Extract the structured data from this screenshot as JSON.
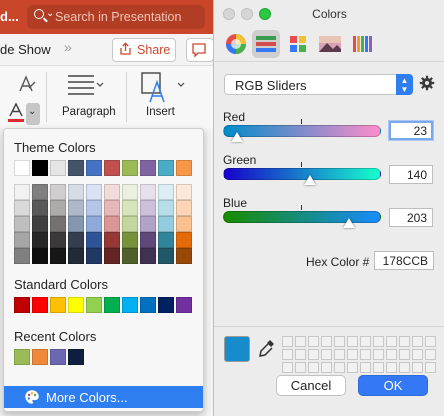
{
  "ppt": {
    "title_fragment": "d...",
    "search_placeholder": "Search in Presentation",
    "tab_fragment": "de Show",
    "tabs_more": "»",
    "share_label": "Share",
    "paragraph_label": "Paragraph",
    "insert_label": "Insert"
  },
  "dropdown": {
    "theme_label": "Theme Colors",
    "standard_label": "Standard Colors",
    "recent_label": "Recent Colors",
    "more_label": "More Colors...",
    "theme_top": [
      "#ffffff",
      "#000000",
      "#e7e6e6",
      "#44546a",
      "#4472c4",
      "#c0504d",
      "#9bbb59",
      "#8064a2",
      "#4bacc6",
      "#f79646"
    ],
    "theme_shades": [
      [
        "#f2f2f2",
        "#d9d9d9",
        "#bfbfbf",
        "#a6a6a6",
        "#808080"
      ],
      [
        "#7f7f7f",
        "#595959",
        "#404040",
        "#262626",
        "#0d0d0d"
      ],
      [
        "#d0cece",
        "#aeabab",
        "#757171",
        "#3a3838",
        "#171616"
      ],
      [
        "#d6dce5",
        "#adb9ca",
        "#8497b0",
        "#333f50",
        "#222a35"
      ],
      [
        "#d9e2f3",
        "#b4c6e7",
        "#8eaadb",
        "#2f5496",
        "#1f3864"
      ],
      [
        "#f2dcdb",
        "#e6b9b8",
        "#d99694",
        "#953734",
        "#632423"
      ],
      [
        "#ebf1de",
        "#d7e4bd",
        "#c3d69b",
        "#76923c",
        "#4f6128"
      ],
      [
        "#e5e0ec",
        "#ccc1da",
        "#b2a2c7",
        "#5f497a",
        "#3f3151"
      ],
      [
        "#dbeef4",
        "#b7dee8",
        "#93cddd",
        "#31859b",
        "#205867"
      ],
      [
        "#fde9d9",
        "#fbd5b5",
        "#fac08f",
        "#e36c09",
        "#974806"
      ]
    ],
    "standard": [
      "#c00000",
      "#ff0000",
      "#ffc000",
      "#ffff00",
      "#92d050",
      "#00b050",
      "#00b0f0",
      "#0070c0",
      "#002060",
      "#7030a0"
    ],
    "recent": [
      "#9bbb59",
      "#f0893c",
      "#6a68b0",
      "#0d1e3f"
    ]
  },
  "panel": {
    "title": "Colors",
    "mode": "RGB Sliders",
    "sliders": [
      {
        "label": "Red",
        "value": "23",
        "fraction": 0.09
      },
      {
        "label": "Green",
        "value": "140",
        "fraction": 0.55
      },
      {
        "label": "Blue",
        "value": "203",
        "fraction": 0.8
      }
    ],
    "hex_label": "Hex Color #",
    "hex_value": "178CCB",
    "current_color": "#178ccb",
    "cancel_label": "Cancel",
    "ok_label": "OK",
    "accent": "#3478f6"
  }
}
